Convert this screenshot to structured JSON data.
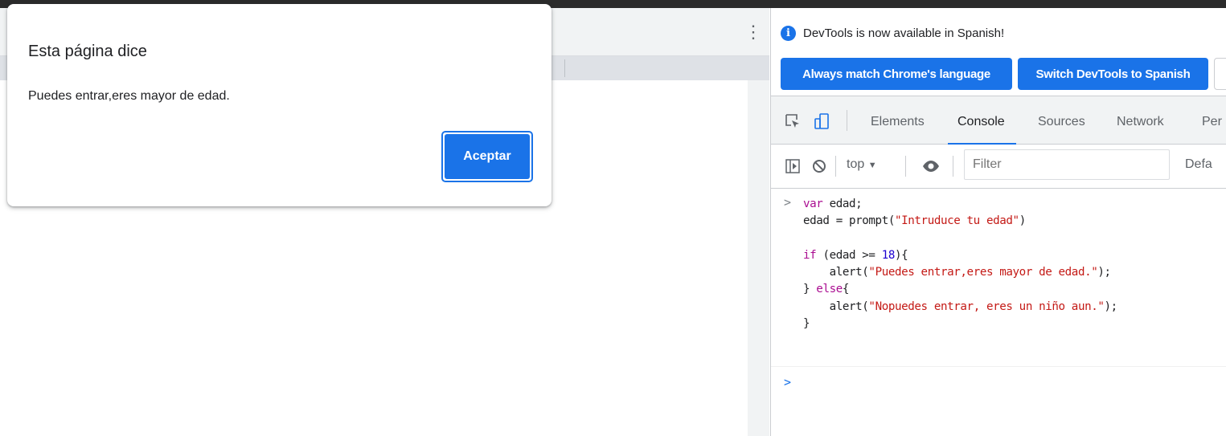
{
  "dialog": {
    "title": "Esta página dice",
    "message": "Puedes entrar,eres mayor de edad.",
    "ok_label": "Aceptar"
  },
  "page": {
    "menu_icon": "kebab-menu-icon"
  },
  "devtools": {
    "infobar": {
      "icon": "info-icon",
      "text": "DevTools is now available in Spanish!",
      "buttons": [
        "Always match Chrome's language",
        "Switch DevTools to Spanish"
      ]
    },
    "tabs": [
      "Elements",
      "Console",
      "Sources",
      "Network",
      "Per"
    ],
    "active_tab": "Console",
    "tool_icons": [
      "inspect-element-icon",
      "device-toolbar-icon"
    ],
    "console_toolbar": {
      "icons": [
        "sidebar-toggle-icon",
        "clear-console-icon",
        "eye-icon"
      ],
      "context": "top",
      "filter_placeholder": "Filter",
      "levels_label": "Defa"
    },
    "console": {
      "input_prompt": ">",
      "code_lines": [
        "var edad;",
        "edad = prompt(\"Intruduce tu edad\")",
        "",
        "if (edad >= 18){",
        "    alert(\"Puedes entrar,eres mayor de edad.\");",
        "} else{",
        "    alert(\"Nopuedes entrar, eres un niño aun.\");",
        "}"
      ],
      "active_prompt": ">"
    },
    "colors": {
      "accent": "#1a73e8",
      "keyword": "#aa0d91",
      "string": "#c41a16",
      "number": "#1c00cf"
    }
  }
}
